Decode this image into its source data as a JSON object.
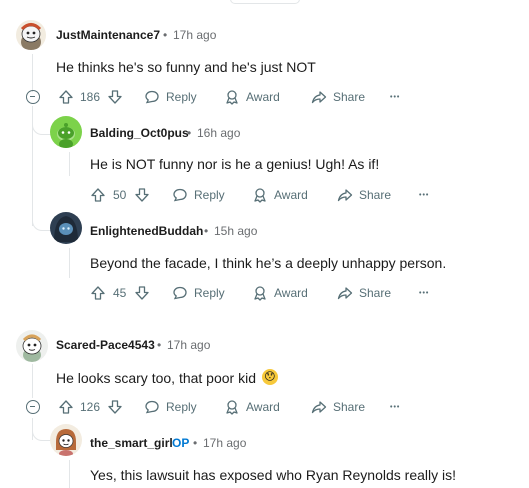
{
  "comments": [
    {
      "username": "JustMaintenance7",
      "time": "17h ago",
      "text": "He thinks he's so funny and he's just NOT",
      "votes": "186",
      "reply": "Reply",
      "award": "Award",
      "share": "Share",
      "more": "•••"
    },
    {
      "username": "Balding_Oct0pus",
      "time": "16h ago",
      "text": "He is NOT funny nor is he a genius! Ugh! As if!",
      "votes": "50",
      "reply": "Reply",
      "award": "Award",
      "share": "Share",
      "more": "•••"
    },
    {
      "username": "EnlightenedBuddah",
      "time": "15h ago",
      "text": "Beyond the facade, I think he’s a deeply unhappy person.",
      "votes": "45",
      "reply": "Reply",
      "award": "Award",
      "share": "Share",
      "more": "•••"
    },
    {
      "username": "Scared-Pace4543",
      "time": "17h ago",
      "text": "He looks scary too, that poor kid",
      "emoji": "😯",
      "votes": "126",
      "reply": "Reply",
      "award": "Award",
      "share": "Share",
      "more": "•••"
    },
    {
      "username": "the_smart_girl",
      "badge": "OP",
      "time": "17h ago",
      "text": "Yes, this lawsuit has exposed who Ryan Reynolds really is!"
    }
  ],
  "separator": "•",
  "colors": {
    "meta": "#576f76",
    "op": "#0079d3",
    "thread": "#e3e6e8"
  }
}
